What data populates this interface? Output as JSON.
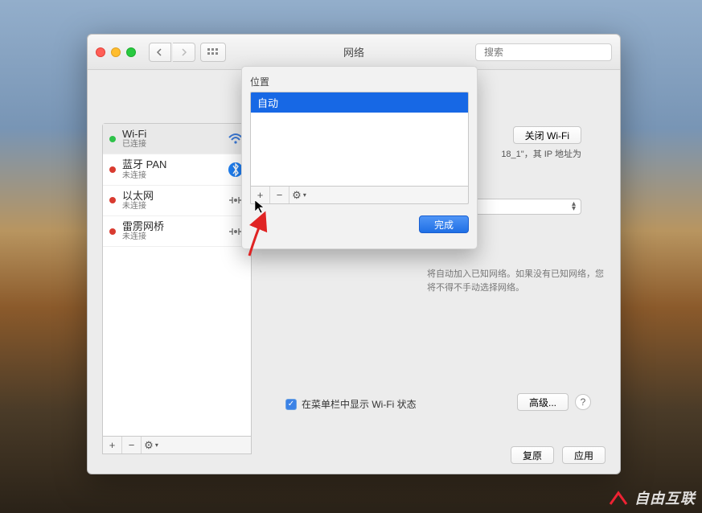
{
  "window": {
    "title": "网络",
    "search_placeholder": "搜索"
  },
  "sidebar": {
    "items": [
      {
        "name": "Wi-Fi",
        "status": "已连接",
        "dot": "green",
        "icon": "wifi",
        "active": true
      },
      {
        "name": "蓝牙 PAN",
        "status": "未连接",
        "dot": "red",
        "icon": "bluetooth",
        "active": false
      },
      {
        "name": "以太网",
        "status": "未连接",
        "dot": "red",
        "icon": "ethernet",
        "active": false
      },
      {
        "name": "雷雳网桥",
        "status": "未连接",
        "dot": "red",
        "icon": "thunderbolt",
        "active": false
      }
    ],
    "footer": {
      "add": "+",
      "remove": "−",
      "gear": "⚙︎"
    }
  },
  "main": {
    "close_wifi": "关闭 Wi-Fi",
    "ip_text": "18_1\"，其 IP 地址为",
    "help_note": "将自动加入已知网络。如果没有已知网络，您将不得不手动选择网络。",
    "show_menu_checkbox": "在菜单栏中显示 Wi-Fi 状态",
    "advanced": "高级...",
    "revert": "复原",
    "apply": "应用"
  },
  "sheet": {
    "label": "位置",
    "items": [
      "自动"
    ],
    "selected_index": 0,
    "add": "+",
    "remove": "−",
    "gear": "⚙︎",
    "done": "完成"
  },
  "watermark": "自由互联"
}
